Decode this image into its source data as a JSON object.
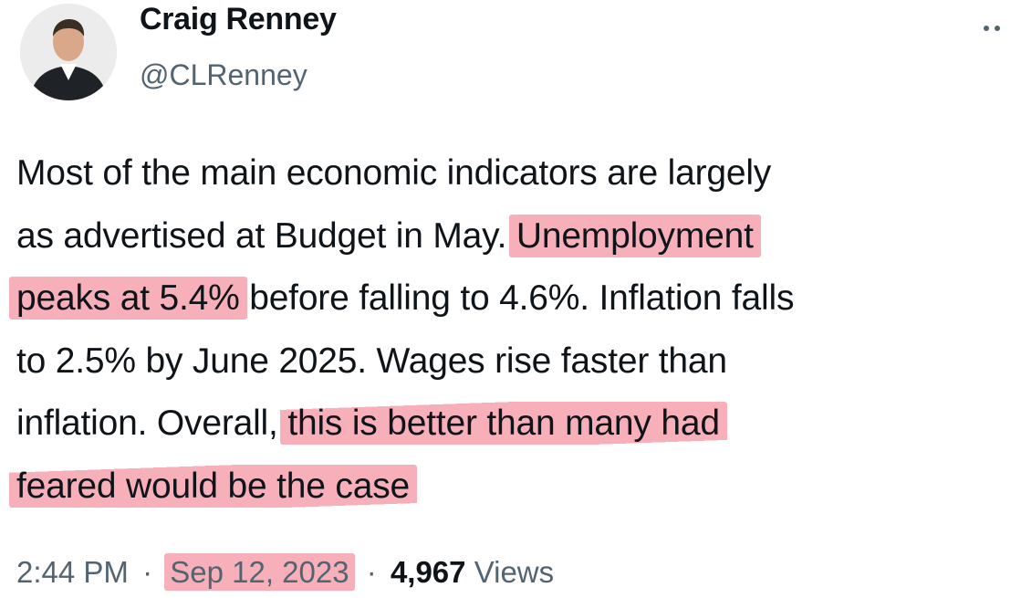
{
  "author": {
    "display_name": "Craig Renney",
    "handle": "@CLRenney",
    "avatar_icon": "profile-photo-avatar"
  },
  "more_icon": "more-dots-icon",
  "tweet": {
    "lines": [
      [
        "Most of the main economic indicators are largely"
      ],
      [
        "as advertised at Budget in May. ",
        "Unemployment"
      ],
      [
        "peaks at 5.4%",
        " before falling to 4.6%. Inflation falls"
      ],
      [
        "to 2.5% by June 2025. Wages rise faster than"
      ],
      [
        "inflation. Overall, ",
        "this is better than many had"
      ],
      [
        "feared would be the case"
      ]
    ],
    "highlight_color": "#f06e82"
  },
  "meta": {
    "time": "2:44 PM",
    "separator": "·",
    "date": "Sep 12, 2023",
    "views_count": "4,967",
    "views_label": "Views"
  }
}
